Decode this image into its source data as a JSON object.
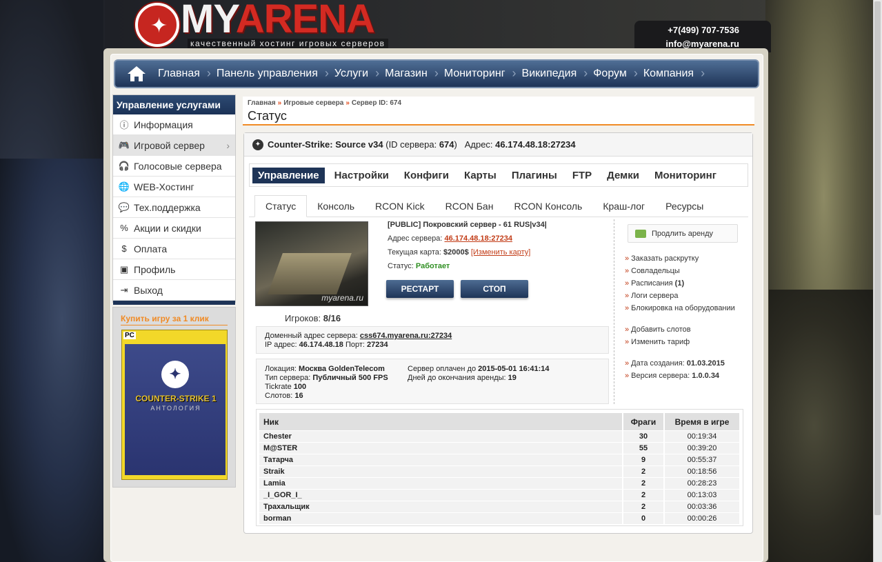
{
  "header": {
    "logo_prefix": "MY",
    "logo_suffix": "ARENA",
    "slogan": "качественный хостинг игровых серверов",
    "phone": "+7(499) 707-7536",
    "email": "info@myarena.ru"
  },
  "nav": {
    "items": [
      "Главная",
      "Панель управления",
      "Услуги",
      "Магазин",
      "Мониторинг",
      "Википедия",
      "Форум",
      "Компания"
    ]
  },
  "sidebar": {
    "title": "Управление услугами",
    "items": [
      {
        "label": "Информация",
        "icon": "info-icon"
      },
      {
        "label": "Игровой сервер",
        "icon": "gamepad-icon"
      },
      {
        "label": "Голосовые сервера",
        "icon": "headset-icon"
      },
      {
        "label": "WEB-Хостинг",
        "icon": "globe-icon"
      },
      {
        "label": "Тех.поддержка",
        "icon": "chat-icon"
      },
      {
        "label": "Акции и скидки",
        "icon": "percent-icon"
      },
      {
        "label": "Оплата",
        "icon": "dollar-icon"
      },
      {
        "label": "Профиль",
        "icon": "profile-icon"
      },
      {
        "label": "Выход",
        "icon": "logout-icon"
      }
    ]
  },
  "buybox": {
    "title": "Купить игру за 1 клик",
    "cover_pc": "PC",
    "cover_title": "COUNTER-STRIKE 1",
    "cover_subtitle": "АНТОЛОГИЯ"
  },
  "breadcrumbs": {
    "home": "Главная",
    "servers": "Игровые сервера",
    "current": "Сервер ID: 674"
  },
  "page_title": "Статус",
  "server": {
    "game": "Counter-Strike: Source v34",
    "id_label": "(ID сервера:",
    "id_value": "674",
    "id_close": ")",
    "address_label": "Адрес:",
    "address_value": "46.174.48.18:27234"
  },
  "tabs_main": [
    "Управление",
    "Настройки",
    "Конфиги",
    "Карты",
    "Плагины",
    "FTP",
    "Демки",
    "Мониторинг"
  ],
  "tabs_sub": [
    "Статус",
    "Консоль",
    "RCON Kick",
    "RCON Бан",
    "RCON Консоль",
    "Краш-лог",
    "Ресурсы"
  ],
  "status": {
    "map_watermark": "myarena.ru",
    "players_label": "Игроков:",
    "players_value": "8/16",
    "server_name": "[PUBLIC] Покровский сервер - 61 RUS|v34|",
    "addr_label": "Адрес сервера:",
    "addr_value": "46.174.48.18:27234",
    "map_label": "Текущая карта:",
    "map_value": "$2000$",
    "map_change": "[Изменить карту]",
    "status_label": "Статус:",
    "status_value": "Работает",
    "restart_btn": "РЕСТАРТ",
    "stop_btn": "СТОП"
  },
  "address_box": {
    "domain_label": "Доменный адрес сервера:",
    "domain_value": "css674.myarena.ru:27234",
    "ip_label": "IP адрес:",
    "ip_value": "46.174.48.18",
    "port_label": "Порт:",
    "port_value": "27234"
  },
  "location_box": {
    "location_label": "Локация:",
    "location_value": "Москва GoldenTelecom",
    "type_label": "Тип сервера:",
    "type_value": "Публичный 500 FPS",
    "tick_label": "Tickrate",
    "tick_value": "100",
    "slots_label": "Слотов:",
    "slots_value": "16",
    "paid_label": "Сервер оплачен до",
    "paid_value": "2015-05-01 16:41:14",
    "days_label": "Дней до окончания аренды:",
    "days_value": "19"
  },
  "right_column": {
    "extend_button": "Продлить аренду",
    "group1": [
      "Заказать раскрутку",
      "Совладельцы",
      "Расписания",
      "Логи сервера",
      "Блокировка на оборудовании"
    ],
    "schedules_count": "(1)",
    "group2": [
      "Добавить слотов",
      "Изменить тариф"
    ],
    "created_label": "Дата создания:",
    "created_value": "01.03.2015",
    "version_label": "Версия сервера:",
    "version_value": "1.0.0.34"
  },
  "players_table": {
    "headers": [
      "Ник",
      "Фраги",
      "Время в игре"
    ],
    "rows": [
      {
        "nick": "Chester",
        "frags": "30",
        "time": "00:19:34"
      },
      {
        "nick": "M@STER",
        "frags": "55",
        "time": "00:39:20"
      },
      {
        "nick": "Татарча",
        "frags": "9",
        "time": "00:55:37"
      },
      {
        "nick": "Straik",
        "frags": "2",
        "time": "00:18:56"
      },
      {
        "nick": "Lamia",
        "frags": "2",
        "time": "00:28:23"
      },
      {
        "nick": "_I_GOR_I_",
        "frags": "2",
        "time": "00:13:03"
      },
      {
        "nick": "Трахальщик",
        "frags": "2",
        "time": "00:03:36"
      },
      {
        "nick": "borman",
        "frags": "0",
        "time": "00:00:26"
      }
    ]
  },
  "colors": {
    "nav_dark": "#1e3457",
    "accent_orange": "#f08a24",
    "link_red": "#c23c17",
    "status_green": "#2f8f22"
  }
}
